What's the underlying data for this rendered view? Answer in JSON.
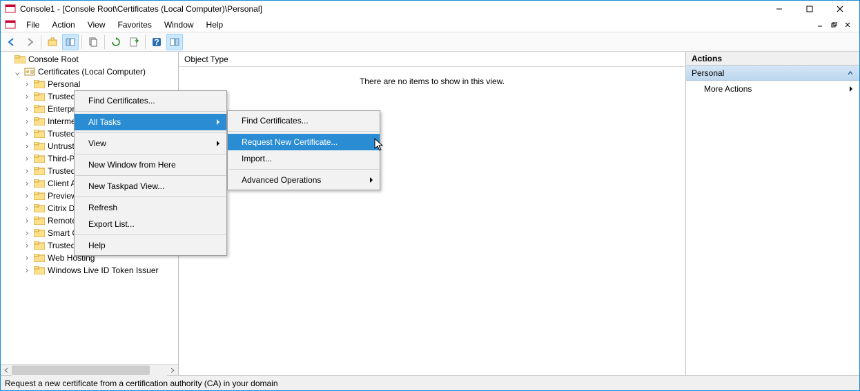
{
  "window": {
    "title": "Console1 - [Console Root\\Certificates (Local Computer)\\Personal]"
  },
  "menubar": {
    "file": "File",
    "action": "Action",
    "view": "View",
    "favorites": "Favorites",
    "window": "Window",
    "help": "Help"
  },
  "tree": {
    "root": "Console Root",
    "certs": "Certificates (Local Computer)",
    "items": [
      "Personal",
      "Trusted",
      "Enterpr",
      "Intermed",
      "Trusted",
      "Untrust",
      "Third-P",
      "Trusted",
      "Client A",
      "Preview",
      "Citrix D",
      "Remote",
      "Smart Card Trusted Roots",
      "Trusted Devices",
      "Web Hosting",
      "Windows Live ID Token Issuer"
    ]
  },
  "main": {
    "col_header": "Object Type",
    "empty": "There are no items to show in this view."
  },
  "actions": {
    "title": "Actions",
    "category": "Personal",
    "more": "More Actions"
  },
  "ctx1": {
    "find": "Find Certificates...",
    "all_tasks": "All Tasks",
    "view": "View",
    "new_window": "New Window from Here",
    "new_taskpad": "New Taskpad View...",
    "refresh": "Refresh",
    "export": "Export List...",
    "help": "Help"
  },
  "ctx2": {
    "find": "Find Certificates...",
    "request": "Request New Certificate...",
    "import": "Import...",
    "advanced": "Advanced Operations"
  },
  "status": "Request a new certificate from a certification authority (CA) in your domain"
}
